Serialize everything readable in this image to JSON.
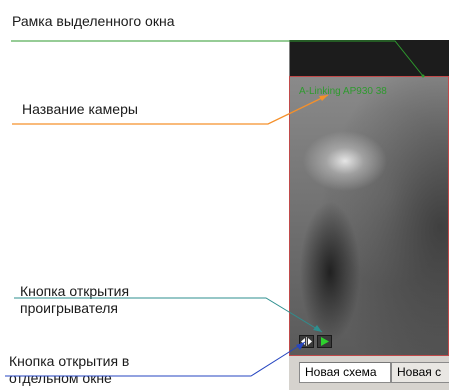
{
  "annotations": {
    "window_frame": "Рамка выделенного окна",
    "camera_name": "Название камеры",
    "player_button_line1": "Кнопка открытия",
    "player_button_line2": "проигрывателя",
    "separate_window_line1": "Кнопка открытия в",
    "separate_window_line2": "отдельном окне"
  },
  "colors": {
    "window_frame": "#2e9a2e",
    "camera_name": "#f5902a",
    "player_button": "#2e8f8f",
    "separate_window": "#2545c0",
    "selected_frame": "#c04a4a"
  },
  "viewport": {
    "camera_label": "A-Linking AP930 38"
  },
  "controls": {
    "expand_icon": "left-right-arrows-icon",
    "play_icon": "play-icon"
  },
  "tabs": [
    {
      "label": "Новая схема",
      "active": true
    },
    {
      "label": "Новая с",
      "active": false
    }
  ]
}
